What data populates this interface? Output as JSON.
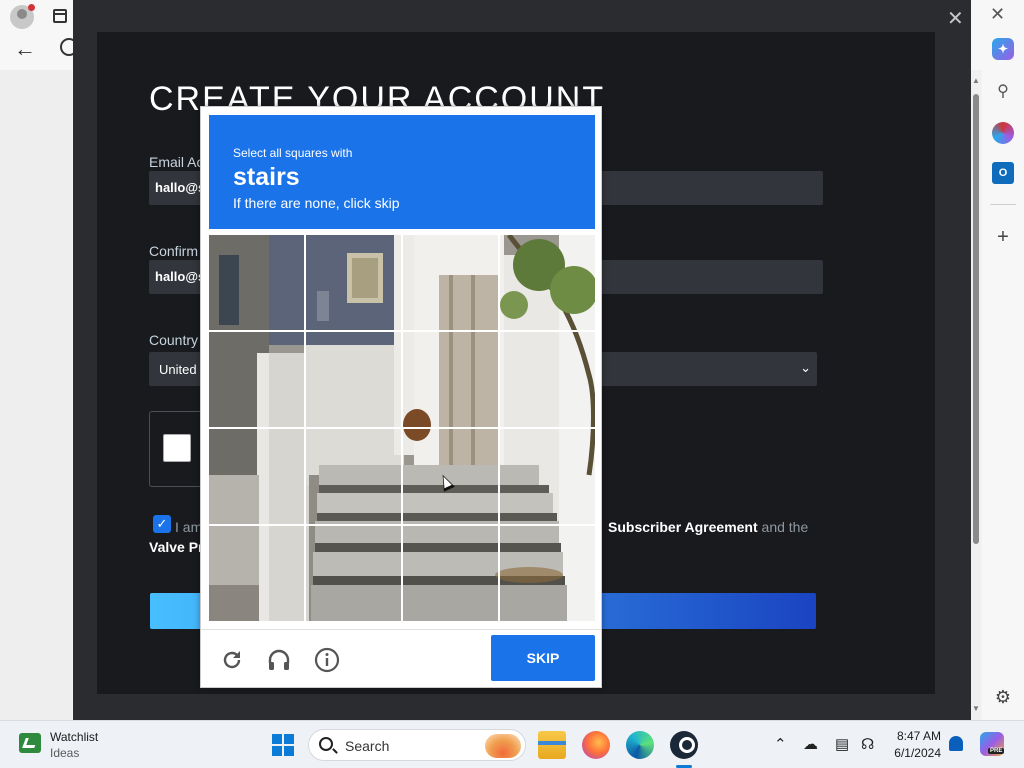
{
  "signup": {
    "title": "CREATE YOUR ACCOUNT",
    "email_label": "Email Ac",
    "email_value": "hallo@s",
    "confirm_label": "Confirm",
    "confirm_value": "hallo@s",
    "country_label": "Country",
    "country_value": "United",
    "agree_prefix": "I am",
    "agree_link1": "Subscriber Agreement",
    "agree_mid": "and the",
    "agree_link2": "Valve Pr"
  },
  "challenge": {
    "line1": "Select all squares with",
    "target": "stairs",
    "line3": "If there are none, click skip",
    "skip_label": "SKIP",
    "header_color": "#1a73e8"
  },
  "icons": {
    "reload": "reload-icon",
    "audio": "headphones-icon",
    "info": "info-icon"
  },
  "taskbar": {
    "widget_title": "Watchlist",
    "widget_sub": "Ideas",
    "search_placeholder": "Search",
    "time": "8:47 AM",
    "date": "6/1/2024"
  }
}
